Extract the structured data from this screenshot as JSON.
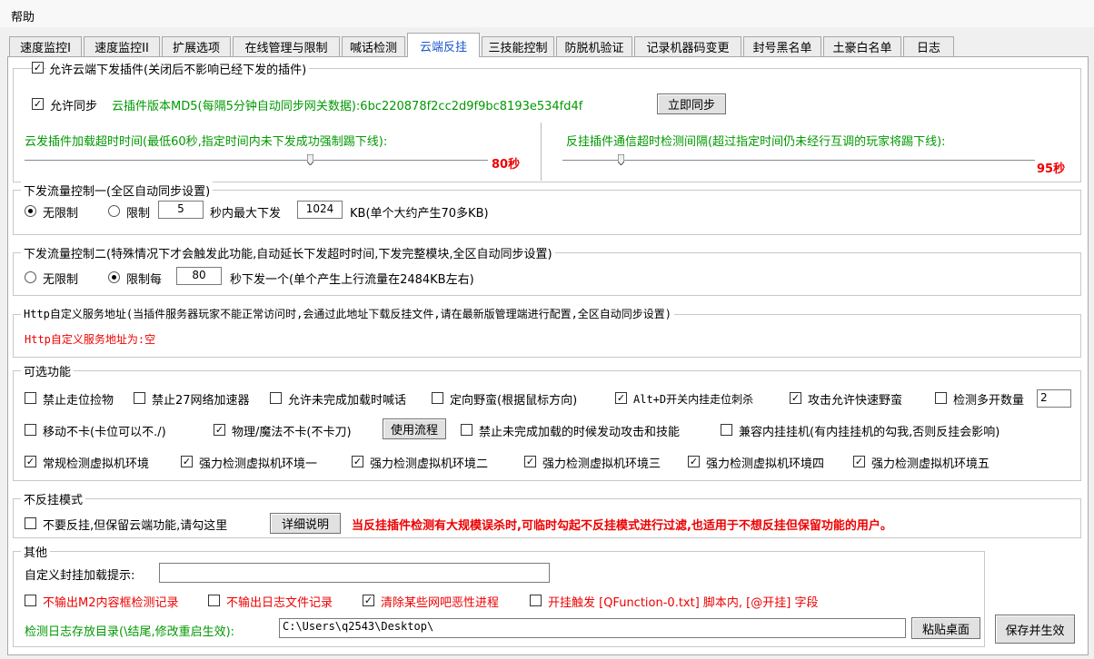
{
  "menu": {
    "help": "帮助"
  },
  "tabs": [
    {
      "label": "速度监控I",
      "active": false
    },
    {
      "label": "速度监控II",
      "active": false
    },
    {
      "label": "扩展选项",
      "active": false
    },
    {
      "label": "在线管理与限制",
      "active": false
    },
    {
      "label": "喊话检测",
      "active": false
    },
    {
      "label": "云端反挂",
      "active": true
    },
    {
      "label": "三技能控制",
      "active": false
    },
    {
      "label": "防脱机验证",
      "active": false
    },
    {
      "label": "记录机器码变更",
      "active": false
    },
    {
      "label": "封号黑名单",
      "active": false
    },
    {
      "label": "土豪白名单",
      "active": false
    },
    {
      "label": "日志",
      "active": false
    }
  ],
  "cloud": {
    "allow_label": "允许云端下发插件(关闭后不影响已经下发的插件)",
    "allow_checked": true,
    "sync_label": "允许同步",
    "sync_checked": true,
    "version_text": "云插件版本MD5(每隔5分钟自动同步网关数据):6bc220878f2cc2d9f9bc8193e534fd4f",
    "sync_now_button": "立即同步",
    "load_timeout_label": "云发插件加载超时时间(最低60秒,指定时间内未下发成功强制踢下线):",
    "load_timeout_value": "80秒",
    "load_timeout_level": 0.6,
    "comm_timeout_label": "反挂插件通信超时检测间隔(超过指定时间仍未经行互调的玩家将踢下线):",
    "comm_timeout_value": "95秒",
    "comm_timeout_level": 0.12
  },
  "flow1": {
    "legend": "下发流量控制一(全区自动同步设置)",
    "unlimited": "无限制",
    "limit": "限制",
    "limit_seconds": "5",
    "max_text": "秒内最大下发",
    "max_kb": "1024",
    "kb_note": "KB(单个大约产生70多KB)",
    "selected": "unlimited"
  },
  "flow2": {
    "legend": "下发流量控制二(特殊情况下才会触发此功能,自动延长下发超时时间,下发完整模块,全区自动同步设置)",
    "unlimited": "无限制",
    "limit_every": "限制每",
    "seconds": "80",
    "note": "秒下发一个(单个产生上行流量在2484KB左右)",
    "selected": "limit"
  },
  "http": {
    "legend": "Http自定义服务地址(当插件服务器玩家不能正常访问时,会通过此地址下载反挂文件,请在最新版管理端进行配置,全区自动同步设置)",
    "value_text": "Http自定义服务地址为:空"
  },
  "optional": {
    "legend": "可选功能",
    "row1": [
      {
        "label": "禁止走位捡物",
        "checked": false
      },
      {
        "label": "禁止27网络加速器",
        "checked": false
      },
      {
        "label": "允许未完成加载时喊话",
        "checked": false
      },
      {
        "label": "定向野蛮(根据鼠标方向)",
        "checked": false
      },
      {
        "label": "Alt+D开关内挂走位刺杀",
        "checked": true
      },
      {
        "label": "攻击允许快速野蛮",
        "checked": true
      },
      {
        "label": "检测多开数量",
        "checked": false
      }
    ],
    "multi_count": "2",
    "row2": [
      {
        "label": "移动不卡(卡位可以不./)",
        "checked": false
      },
      {
        "label": "物理/魔法不卡(不卡刀)",
        "checked": true
      },
      {
        "label": "禁止未完成加载的时候发动攻击和技能",
        "checked": false
      },
      {
        "label": "兼容内挂挂机(有内挂挂机的勾我,否则反挂会影响)",
        "checked": false
      }
    ],
    "flow_button": "使用流程",
    "row3": [
      {
        "label": "常规检测虚拟机环境",
        "checked": true
      },
      {
        "label": "强力检测虚拟机环境一",
        "checked": true
      },
      {
        "label": "强力检测虚拟机环境二",
        "checked": true
      },
      {
        "label": "强力检测虚拟机环境三",
        "checked": true
      },
      {
        "label": "强力检测虚拟机环境四",
        "checked": true
      },
      {
        "label": "强力检测虚拟机环境五",
        "checked": true
      }
    ]
  },
  "noanti": {
    "legend": "不反挂模式",
    "label": "不要反挂,但保留云端功能,请勾这里",
    "checked": false,
    "detail_button": "详细说明",
    "warning": "当反挂插件检测有大规模误杀时,可临时勾起不反挂模式进行过滤,也适用于不想反挂但保留功能的用户。"
  },
  "other": {
    "legend": "其他",
    "custom_hint_label": "自定义封挂加载提示:",
    "custom_hint_value": "",
    "checks": [
      {
        "label": "不输出M2内容框检测记录",
        "checked": false
      },
      {
        "label": "不输出日志文件记录",
        "checked": false
      },
      {
        "label": "清除某些网吧恶性进程",
        "checked": true
      },
      {
        "label": "开挂触发 [QFunction-0.txt] 脚本内, [@开挂] 字段",
        "checked": false
      }
    ],
    "log_dir_label": "检测日志存放目录(\\结尾,修改重启生效):",
    "log_dir_value": "C:\\Users\\q2543\\Desktop\\",
    "paste_button": "粘贴桌面",
    "save_button": "保存并生效"
  }
}
